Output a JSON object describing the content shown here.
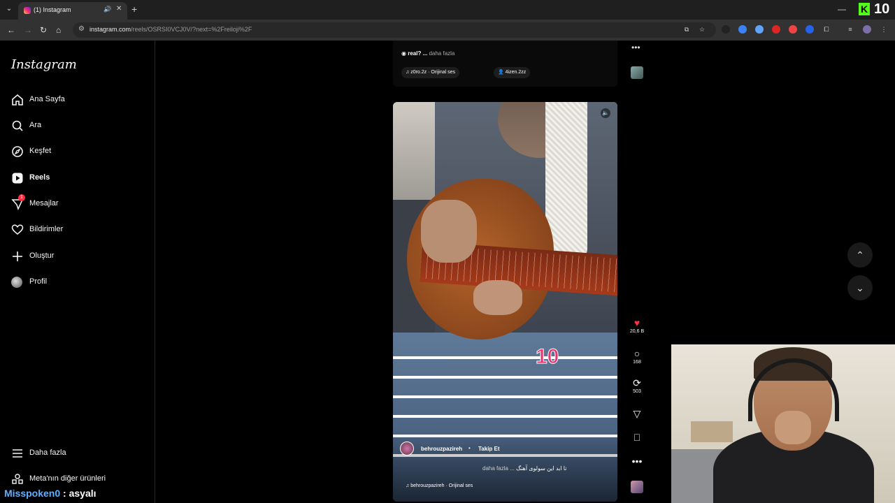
{
  "browser": {
    "tab_title": "(1) Instagram",
    "url_host": "instagram.com",
    "url_path": "/reels/OSRSI0VCJ0V/?next=%2Freiloji%2F",
    "kick_count": "10"
  },
  "sidebar": {
    "logo": "Instagram",
    "items": [
      {
        "label": "Ana Sayfa"
      },
      {
        "label": "Ara"
      },
      {
        "label": "Keşfet"
      },
      {
        "label": "Reels"
      },
      {
        "label": "Mesajlar"
      },
      {
        "label": "Bildirimler"
      },
      {
        "label": "Oluştur"
      },
      {
        "label": "Profil"
      }
    ],
    "messages_badge": "1",
    "more_label": "Daha fazla",
    "meta_label": "Meta'nın diğer ürünleri"
  },
  "prev_reel": {
    "caption": "real? ...",
    "more": "daha fazla",
    "audio": "z0ro.2z · Orijinal ses",
    "tagged": "4izen.2zz"
  },
  "reel": {
    "overlay_number": "10",
    "author": "behrouzpazireh",
    "dot": "•",
    "follow_label": "Takip Et",
    "caption_more": "daha fazla ...",
    "caption_text": "تا ابد این سولوی آهنگ",
    "audio": "behrouzpazireh · Orijinal ses"
  },
  "actions": {
    "likes": "20,6 B",
    "comments": "168",
    "reposts": "503"
  },
  "chat": {
    "user": "Misspoken0",
    "message": ": asyalı"
  },
  "colors": {
    "accent_like": "#ff3040",
    "kick_green": "#53fc18",
    "overlay_pink": "#e8336e"
  }
}
